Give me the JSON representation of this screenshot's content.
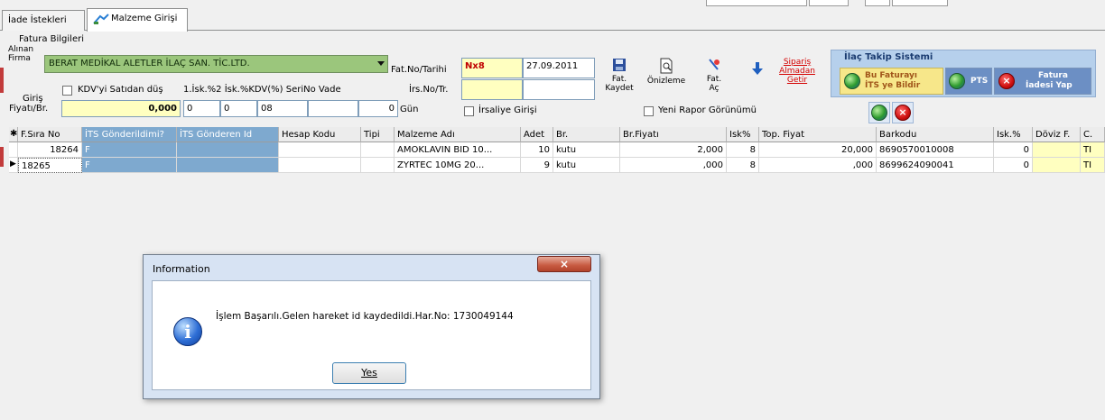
{
  "tabs": [
    {
      "label": "İade İstekleri"
    },
    {
      "label": "Malzeme Girişi"
    }
  ],
  "invoice": {
    "group_label": "Fatura Bilgileri",
    "firm_label_1": "Alınan",
    "firm_label_2": "Firma",
    "firm_value": "BERAT MEDİKAL ALETLER İLAÇ SAN. TİC.LTD.",
    "entry_label_1": "Giriş",
    "entry_label_2": "Fiyatı/Br.",
    "entry_value": "0,000",
    "vat_checkbox_label": "KDV'yi Satıdan düş",
    "discount_headers": "1.İsk.%2 İsk.%KDV(%) SeriNo   Vade",
    "isk1": "0",
    "isk2": "0",
    "kdv": "08",
    "vade": "0",
    "gun_label": "Gün",
    "fatno_label": "Fat.No/Tarihi",
    "fatno_value": "Nx8",
    "date_value": "27.09.2011",
    "irsno_label": "İrs.No/Tr.",
    "iraliye_label": "İrsaliye Girişi",
    "new_report_label": "Yeni Rapor Görünümü"
  },
  "toolbar": {
    "save_label_1": "Fat.",
    "save_label_2": "Kaydet",
    "preview_label": "Önizleme",
    "open_label_1": "Fat.",
    "open_label_2": "Aç",
    "order_label_1": "Sipariş",
    "order_label_2": "Almadan",
    "order_label_3": "Getir"
  },
  "its": {
    "title": "İlaç Takip Sistemi",
    "notify_line1": "Bu Faturayı",
    "notify_line2": "İTS ye Bildir",
    "pts_label": "PTS",
    "cancel_line1": "Fatura",
    "cancel_line2": "İadesi Yap"
  },
  "grid": {
    "headers": [
      "F.Sıra No",
      "İTS Gönderildimi?",
      "İTS Gönderen Id",
      "Hesap Kodu",
      "Tipi",
      "Malzeme Adı",
      "Adet",
      "Br.",
      "Br.Fiyatı",
      "Isk%",
      "Top. Fiyat",
      "Barkodu",
      "Isk.%",
      "Döviz F.",
      "C."
    ],
    "rows": [
      [
        "18264",
        "F",
        "",
        "",
        "",
        "AMOKLAVIN BID 10...",
        "10",
        "kutu",
        "2,000",
        "8",
        "20,000",
        "8690570010008",
        "0",
        "",
        "TI"
      ],
      [
        "18265",
        "F",
        "",
        "",
        "",
        "ZYRTEC 10MG 20...",
        "9",
        "kutu",
        ",000",
        "8",
        ",000",
        "8699624090041",
        "0",
        "",
        "TI"
      ]
    ]
  },
  "dialog": {
    "title": "Information",
    "message": "İşlem Başarılı.Gelen hareket id kaydedildi.Har.No: 1730049144",
    "yes_label": "Yes"
  },
  "colors": {
    "combo_green": "#9bc67c",
    "grid_blue": "#7ea9cf",
    "input_yellow": "#ffffc0",
    "its_panel": "#b6d0ec",
    "link_red": "#d40000"
  },
  "icons": [
    "save-icon",
    "preview-icon",
    "open-icon",
    "arrow-down-icon",
    "globe-icon",
    "cancel-icon",
    "info-icon"
  ]
}
